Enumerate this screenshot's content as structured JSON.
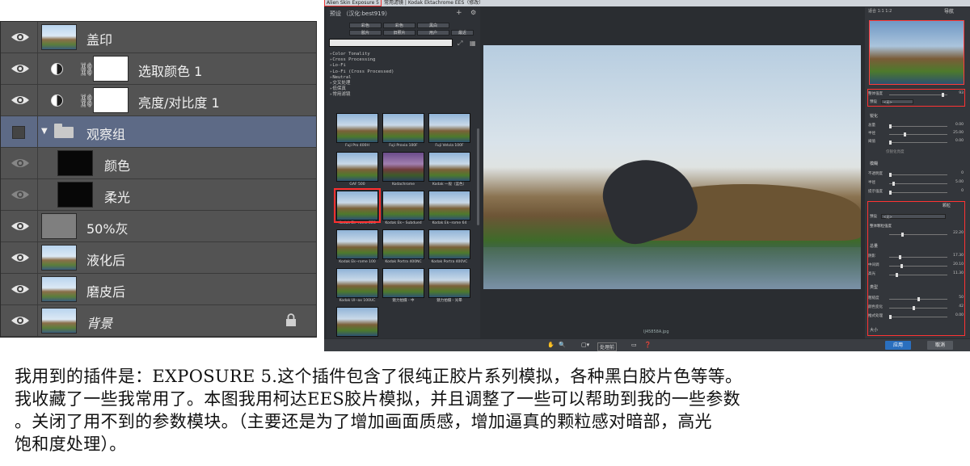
{
  "layers_panel": {
    "layers": [
      {
        "name": "盖印",
        "visible": true,
        "thumb": "photo"
      },
      {
        "name": "选取颜色 1",
        "visible": true,
        "thumb": "white",
        "adjustment": true
      },
      {
        "name": "亮度/对比度 1",
        "visible": true,
        "thumb": "white",
        "adjustment": true
      },
      {
        "name": "观察组",
        "visible": false,
        "group": true,
        "selected": true
      },
      {
        "name": "颜色",
        "visible": true,
        "dim": true,
        "thumb": "black"
      },
      {
        "name": "柔光",
        "visible": true,
        "dim": true,
        "thumb": "black"
      },
      {
        "name": "50%灰",
        "visible": true,
        "thumb": "gray"
      },
      {
        "name": "液化后",
        "visible": true,
        "thumb": "photo"
      },
      {
        "name": "磨皮后",
        "visible": true,
        "thumb": "photo"
      },
      {
        "name": "背景",
        "visible": true,
        "thumb": "photo",
        "locked": true,
        "italic": true
      }
    ]
  },
  "exposure": {
    "title_app": "Alien Skin Exposure 5",
    "title_rest": "常用滤镜 | Kodak Ektachrome EES（修改）",
    "presets_header": "预设  （汉化:best919）",
    "filter_buttons": [
      "彩色",
      "彩色",
      "黑白",
      "胶片",
      "旧照片",
      "用户",
      "最近"
    ],
    "categories": [
      "Color Tonality",
      "Cross Processing",
      "Lo-Fi",
      "Lo-Fi (Cross Processed)",
      "Neutral",
      "交叉处理",
      "低保真",
      "常用滤镜"
    ],
    "presets": [
      {
        "label": "Fuji Pro 400H"
      },
      {
        "label": "Fuji Provia 100F"
      },
      {
        "label": "Fuji Velvia 100F"
      },
      {
        "label": "GAF 500"
      },
      {
        "label": "Kodachrome",
        "purple": true
      },
      {
        "label": "Kodak 一般（蓝色）"
      },
      {
        "label": "Kodak Ek--rome EES",
        "selected": true
      },
      {
        "label": "Kodak Ek-- Subdued"
      },
      {
        "label": "Kodak Ek--rome 64"
      },
      {
        "label": "Kodak Ek--rome 100"
      },
      {
        "label": "Kodak Portra 400NC"
      },
      {
        "label": "Kodak Portra 400VC"
      },
      {
        "label": "Kodak Ul--ax 100UC"
      },
      {
        "label": "魅力拍摄 - 中"
      },
      {
        "label": "魅力拍摄 - 光晕"
      },
      {
        "label": ""
      }
    ],
    "preview_filename": "IJ45858A.jpg",
    "bottom_bar": {
      "preview_mode": "处理前",
      "apply": "应用",
      "cancel": "取消"
    },
    "right_panel": {
      "zoom_label": "适合  1:1  1:2",
      "nav_title": "导航",
      "overall_strength": {
        "label": "整体强度",
        "value": "93",
        "fraction": 0.93
      },
      "preset_label": "预设",
      "preset_value": "<无>",
      "sharpen_title": "锐化",
      "sharpen": [
        {
          "label": "总量",
          "value": "0.00",
          "fraction": 0.0
        },
        {
          "label": "半径",
          "value": "25.00",
          "fraction": 0.25
        },
        {
          "label": "阈值",
          "value": "0.00",
          "fraction": 0.0
        }
      ],
      "sharpen_check": "仅锐化亮度",
      "blur_title": "模糊",
      "blur": [
        {
          "label": "不透明度",
          "value": "0",
          "fraction": 0.0
        },
        {
          "label": "半径",
          "value": "5.00",
          "fraction": 0.05
        },
        {
          "label": "提示强度",
          "value": "0",
          "fraction": 0.0
        }
      ],
      "grain_title": "颗粒",
      "grain_preset": "<无>",
      "grain_overall_label": "整体颗粒强度",
      "grain_overall": {
        "value": "22.20",
        "fraction": 0.22
      },
      "grain_amount_title": "总量",
      "grain_amount": [
        {
          "label": "阴影",
          "value": "17.30",
          "fraction": 0.17
        },
        {
          "label": "中间调",
          "value": "20.10",
          "fraction": 0.2
        },
        {
          "label": "高光",
          "value": "11.30",
          "fraction": 0.11
        }
      ],
      "grain_type_title": "类型",
      "grain_type": [
        {
          "label": "粗糙度",
          "value": "50",
          "fraction": 0.5
        },
        {
          "label": "颜色变化",
          "value": "42",
          "fraction": 0.42
        },
        {
          "label": "推式处理",
          "value": "0.00",
          "fraction": 0.0
        }
      ],
      "size_title": "大小"
    }
  },
  "caption": {
    "lines": [
      "我用到的插件是：EXPOSURE 5.这个插件包含了很纯正胶片系列模拟，各种黑白胶片色等等。",
      "我收藏了一些我常用了。本图我用柯达EES胶片模拟，并且调整了一些可以帮助到我的一些参数",
      "。关闭了用不到的参数模块。（主要还是为了增加画面质感，增加逼真的颗粒感对暗部，高光",
      "饱和度处理）。"
    ]
  }
}
